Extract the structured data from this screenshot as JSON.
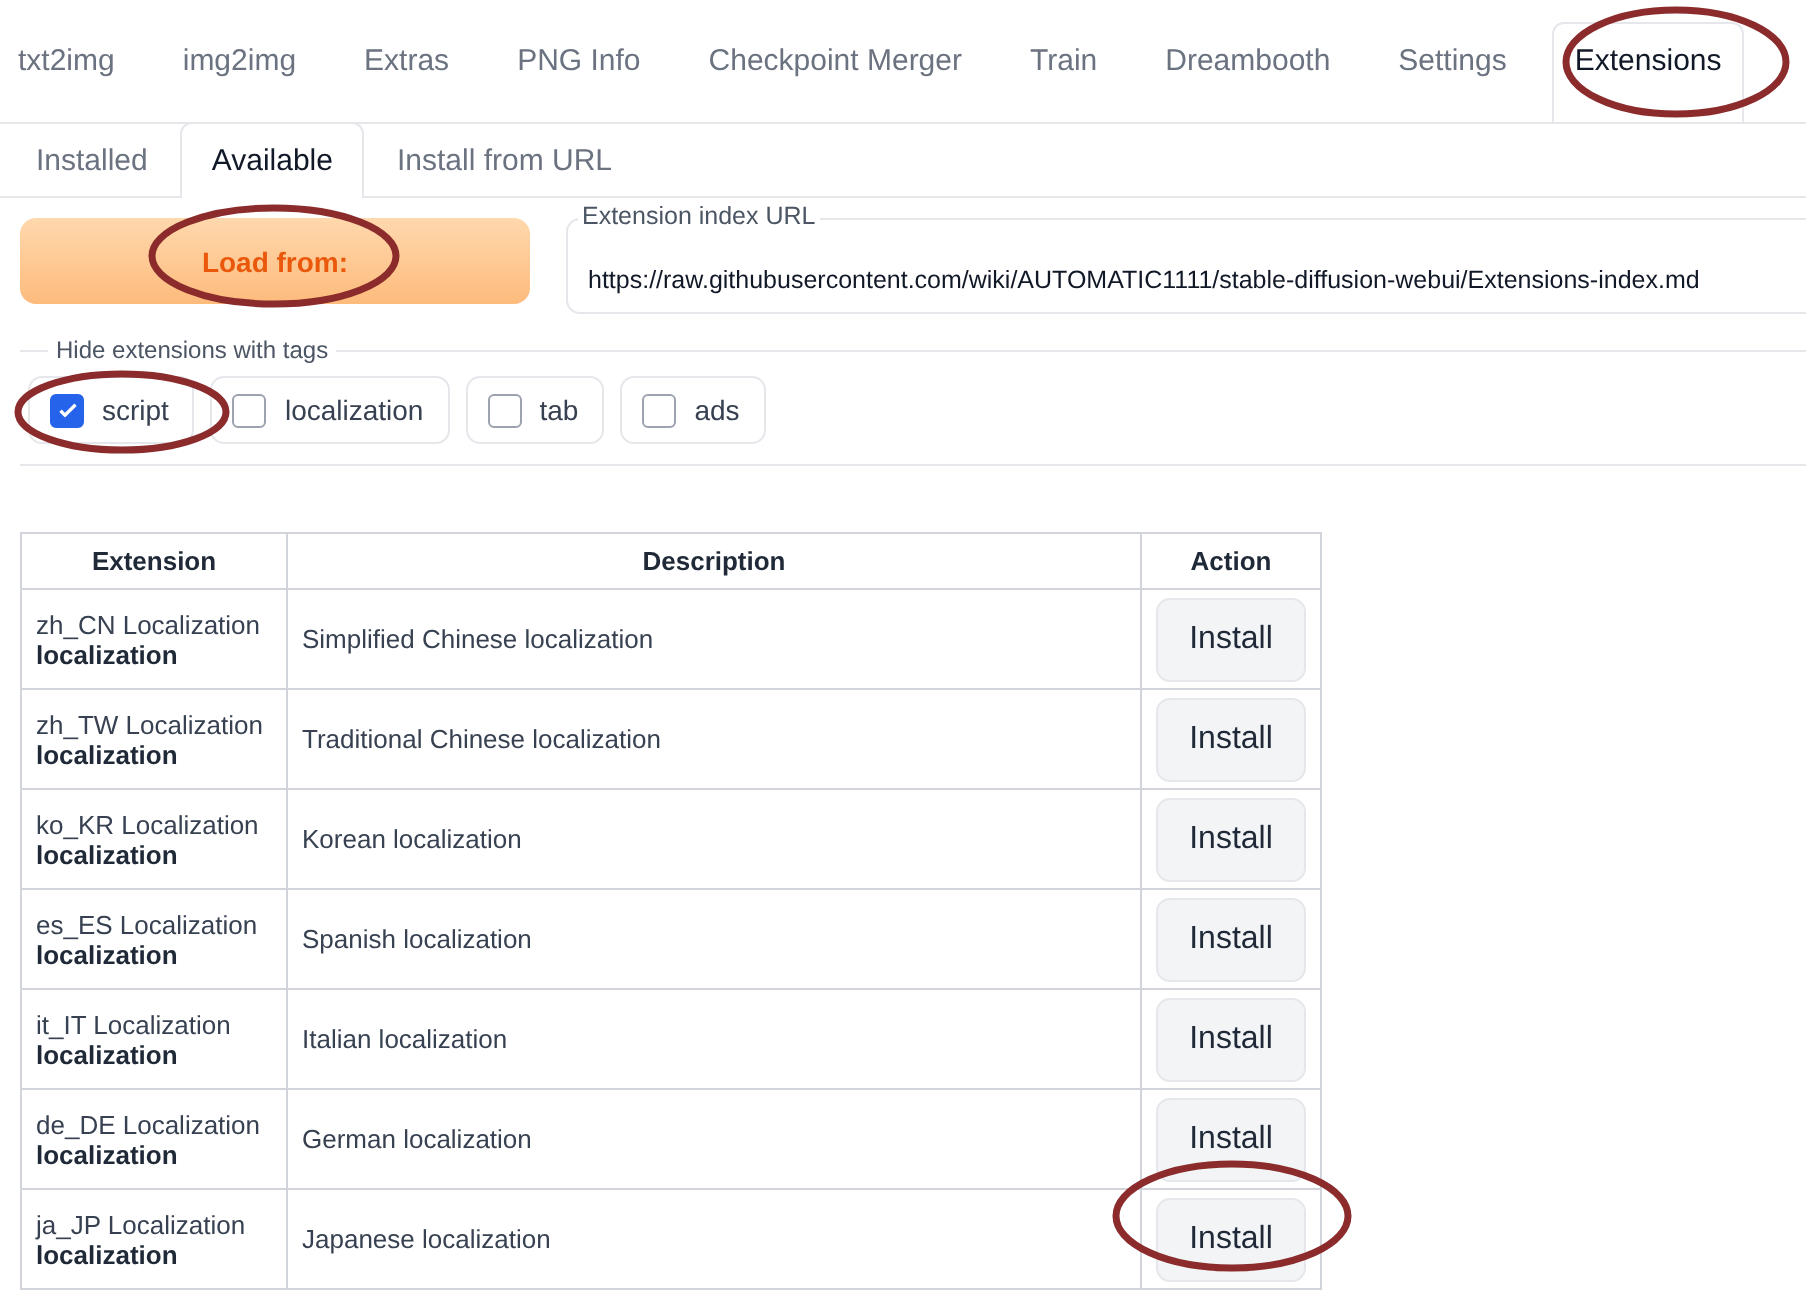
{
  "main_tabs": [
    {
      "label": "txt2img",
      "selected": false
    },
    {
      "label": "img2img",
      "selected": false
    },
    {
      "label": "Extras",
      "selected": false
    },
    {
      "label": "PNG Info",
      "selected": false
    },
    {
      "label": "Checkpoint Merger",
      "selected": false
    },
    {
      "label": "Train",
      "selected": false
    },
    {
      "label": "Dreambooth",
      "selected": false
    },
    {
      "label": "Settings",
      "selected": false
    },
    {
      "label": "Extensions",
      "selected": true
    }
  ],
  "sub_tabs": [
    {
      "label": "Installed",
      "selected": false
    },
    {
      "label": "Available",
      "selected": true
    },
    {
      "label": "Install from URL",
      "selected": false
    }
  ],
  "load_button": "Load from:",
  "index_url": {
    "label": "Extension index URL",
    "value": "https://raw.githubusercontent.com/wiki/AUTOMATIC1111/stable-diffusion-webui/Extensions-index.md"
  },
  "hide_tags": {
    "legend": "Hide extensions with tags",
    "tags": [
      {
        "label": "script",
        "checked": true
      },
      {
        "label": "localization",
        "checked": false
      },
      {
        "label": "tab",
        "checked": false
      },
      {
        "label": "ads",
        "checked": false
      }
    ]
  },
  "table": {
    "columns": [
      "Extension",
      "Description",
      "Action"
    ],
    "rows": [
      {
        "name": "zh_CN Localization",
        "tag": "localization",
        "description": "Simplified Chinese localization",
        "action": "Install"
      },
      {
        "name": "zh_TW Localization",
        "tag": "localization",
        "description": "Traditional Chinese localization",
        "action": "Install"
      },
      {
        "name": "ko_KR Localization",
        "tag": "localization",
        "description": "Korean localization",
        "action": "Install"
      },
      {
        "name": "es_ES Localization",
        "tag": "localization",
        "description": "Spanish localization",
        "action": "Install"
      },
      {
        "name": "it_IT Localization",
        "tag": "localization",
        "description": "Italian localization",
        "action": "Install"
      },
      {
        "name": "de_DE Localization",
        "tag": "localization",
        "description": "German localization",
        "action": "Install"
      },
      {
        "name": "ja_JP Localization",
        "tag": "localization",
        "description": "Japanese localization",
        "action": "Install"
      }
    ]
  }
}
